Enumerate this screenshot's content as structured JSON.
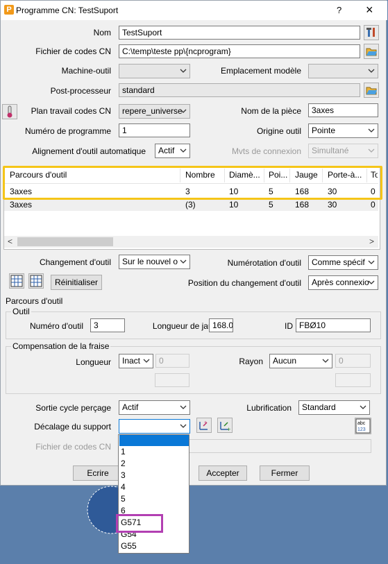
{
  "window": {
    "title": "Programme CN: TestSuport",
    "help": "?",
    "close": "×"
  },
  "form": {
    "nom_label": "Nom",
    "nom_value": "TestSuport",
    "fichier_label": "Fichier de codes CN",
    "fichier_value": "C:\\temp\\teste pp\\{ncprogram}",
    "machine_label": "Machine-outil",
    "machine_value": "",
    "emplacement_label": "Emplacement modèle",
    "emplacement_value": "",
    "post_label": "Post-processeur",
    "post_value": "standard",
    "plan_label": "Plan travail codes CN",
    "plan_value": "repere_universe",
    "nom_piece_label": "Nom de la pièce",
    "nom_piece_value": "3axes",
    "numero_prog_label": "Numéro de programme",
    "numero_prog_value": "1",
    "origine_label": "Origine outil",
    "origine_value": "Pointe",
    "alignement_label": "Alignement d'outil automatique",
    "alignement_value": "Actif",
    "mvts_label": "Mvts de connexion",
    "mvts_value": "Simultané"
  },
  "table": {
    "headers": [
      "Parcours d'outil",
      "Nombre",
      "Diamè...",
      "Poi...",
      "Jauge",
      "Porte-à...",
      "To"
    ],
    "rows": [
      [
        "3axes",
        "3",
        "10",
        "5",
        "168",
        "30",
        "0"
      ],
      [
        "3axes",
        "(3)",
        "10",
        "5",
        "168",
        "30",
        "0"
      ]
    ],
    "scroll_left": "<",
    "scroll_right": ">"
  },
  "change": {
    "changement_label": "Changement d'outil",
    "changement_value": "Sur le nouvel o",
    "numerotation_label": "Numérotation d'outil",
    "numerotation_value": "Comme spécif",
    "reinit_label": "Réinitialiser",
    "position_label": "Position du changement d'outil",
    "position_value": "Après connexio"
  },
  "parcours": {
    "title": "Parcours d'outil",
    "outil_title": "Outil",
    "numero_outil_label": "Numéro d'outil",
    "numero_outil_value": "3",
    "longueur_jauge_label": "Longueur de jauge",
    "longueur_jauge_value": "168.0",
    "id_label": "ID",
    "id_value": "FBØ10",
    "comp_title": "Compensation de la fraise",
    "longueur_label": "Longueur",
    "longueur_value": "Inact",
    "longueur_num": "0",
    "rayon_label": "Rayon",
    "rayon_value": "Aucun",
    "rayon_num": "0"
  },
  "bottom": {
    "sortie_label": "Sortie cycle perçage",
    "sortie_value": "Actif",
    "lubrif_label": "Lubrification",
    "lubrif_value": "Standard",
    "decalage_label": "Décalage du support",
    "decalage_value": "",
    "fichier_label": "Fichier de codes CN"
  },
  "dropdown": {
    "options": [
      "",
      "1",
      "2",
      "3",
      "4",
      "5",
      "6",
      "G571",
      "G54",
      "G55"
    ]
  },
  "buttons": {
    "ecrire": "Ecrire",
    "accepter": "Accepter",
    "fermer": "Fermer"
  },
  "colors": {
    "highlight_table": "#f5c518",
    "highlight_option": "#b23fb2",
    "selection": "#0a78d7",
    "desktop": "#5b7fab"
  }
}
